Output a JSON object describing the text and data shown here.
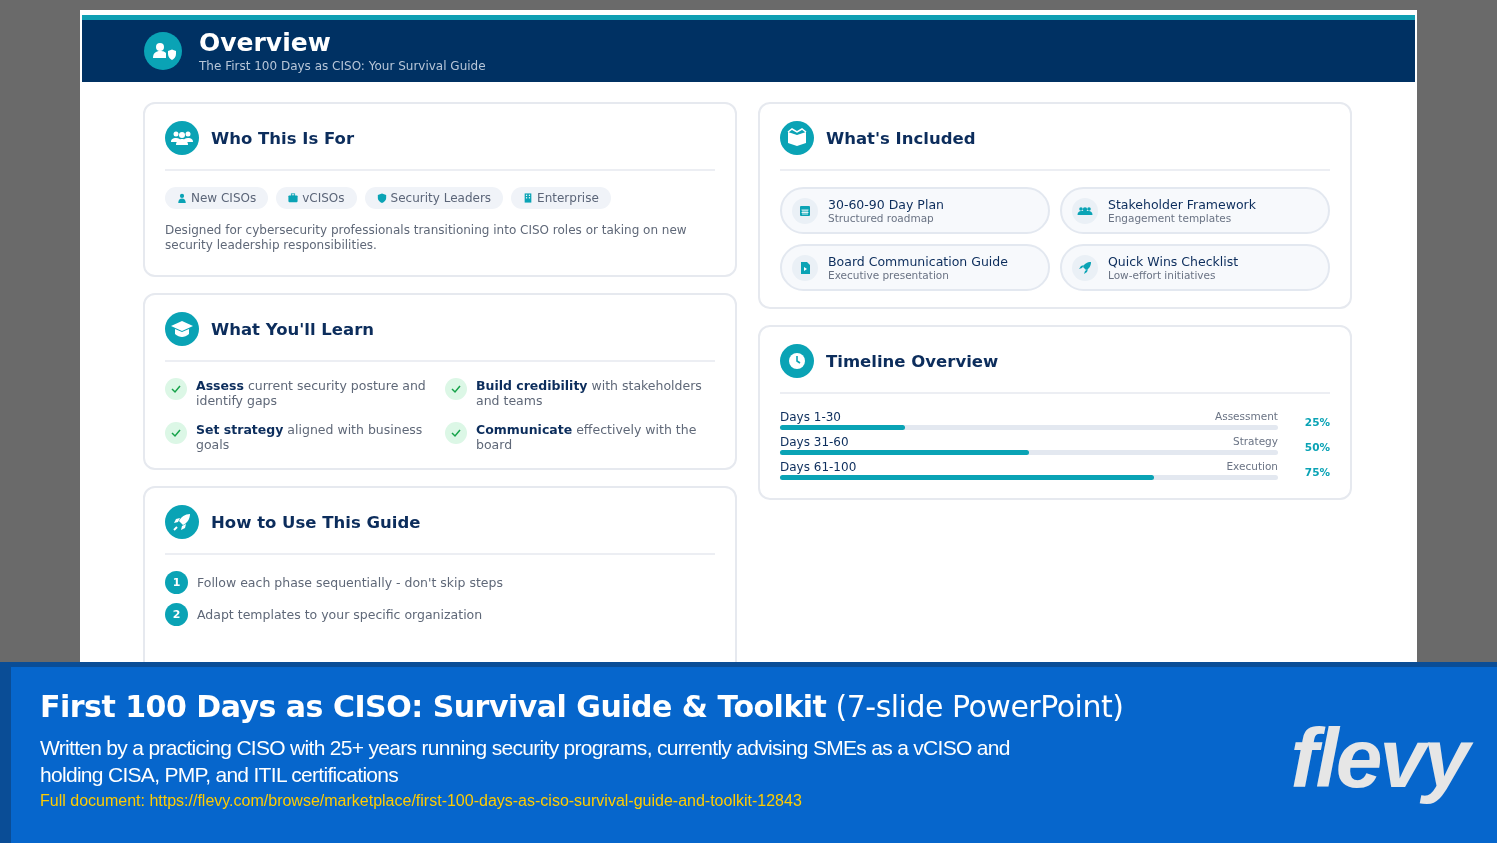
{
  "header": {
    "title": "Overview",
    "subtitle": "The First 100 Days as CISO: Your Survival Guide"
  },
  "who": {
    "title": "Who This Is For",
    "tags": [
      {
        "label": "New CISOs",
        "kind": "person"
      },
      {
        "label": "vCISOs",
        "kind": "briefcase"
      },
      {
        "label": "Security Leaders",
        "kind": "shield"
      },
      {
        "label": "Enterprise",
        "kind": "building"
      }
    ],
    "description": "Designed for cybersecurity professionals transitioning into CISO roles or taking on new security leadership responsibilities."
  },
  "learn": {
    "title": "What You'll Learn",
    "items": [
      "**Assess** current security posture and identify gaps",
      "**Build credibility** with stakeholders and teams",
      "**Set strategy** aligned with business goals",
      "**Communicate** effectively with the board"
    ]
  },
  "guide": {
    "title": "How to Use This Guide",
    "steps": [
      {
        "number": "1",
        "text": "Follow each phase sequentially - don't skip steps"
      },
      {
        "number": "2",
        "text": "Adapt templates to your specific organization"
      }
    ]
  },
  "included": {
    "title": "What's Included",
    "items": [
      {
        "kind": "calendar",
        "title": "30-60-90 Day Plan",
        "subtitle": "Structured roadmap"
      },
      {
        "kind": "people",
        "title": "Stakeholder Framework",
        "subtitle": "Engagement templates"
      },
      {
        "kind": "document",
        "title": "Board Communication Guide",
        "subtitle": "Executive presentation"
      },
      {
        "kind": "rocket",
        "title": "Quick Wins Checklist",
        "subtitle": "Low-effort initiatives"
      }
    ]
  },
  "timeline": {
    "title": "Timeline Overview",
    "phases": [
      {
        "label": "Days 1-30",
        "phase": "Assessment",
        "percent": "25%",
        "level": 0.25
      },
      {
        "label": "Days 31-60",
        "phase": "Strategy",
        "percent": "50%",
        "level": 0.5
      },
      {
        "label": "Days 61-100",
        "phase": "Execution",
        "percent": "75%",
        "level": 0.75
      }
    ]
  },
  "banner": {
    "title": "First 100 Days as CISO: Survival Guide & Toolkit",
    "format": "(7-slide PowerPoint)",
    "description": "Written by a practicing CISO with 25+ years running security programs, currently advising SMEs as a vCISO and holding CISA, PMP, and ITIL certifications",
    "link": "Full document: https://flevy.com/browse/marketplace/first-100-days-as-ciso-survival-guide-and-toolkit-12843",
    "logo": "flevy"
  }
}
